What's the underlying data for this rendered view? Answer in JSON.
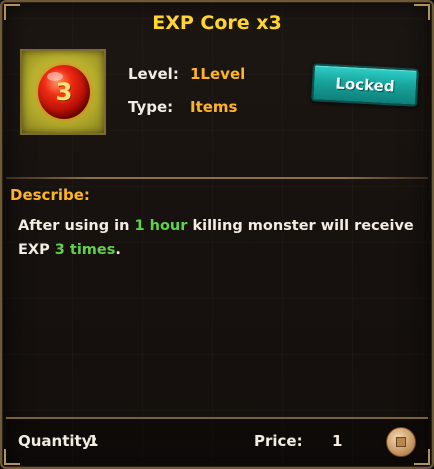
{
  "item": {
    "title": "EXP Core x3",
    "badge": "3",
    "level_label": "Level:",
    "level_value": "1Level",
    "type_label": "Type:",
    "type_value": "Items",
    "status_button": "Locked"
  },
  "description": {
    "label": "Describe:",
    "parts": [
      "After using in ",
      "1 hour",
      " killing monster will receive EXP ",
      "3 times",
      "."
    ]
  },
  "footer": {
    "quantity_label": "Quantity:",
    "quantity_value": "1",
    "price_label": "Price:",
    "price_value": "1",
    "currency_icon": "coin-icon"
  },
  "colors": {
    "title": "#ffd531",
    "value": "#ffb428",
    "highlight": "#5fd24a",
    "locked_button": "#17a49d"
  }
}
